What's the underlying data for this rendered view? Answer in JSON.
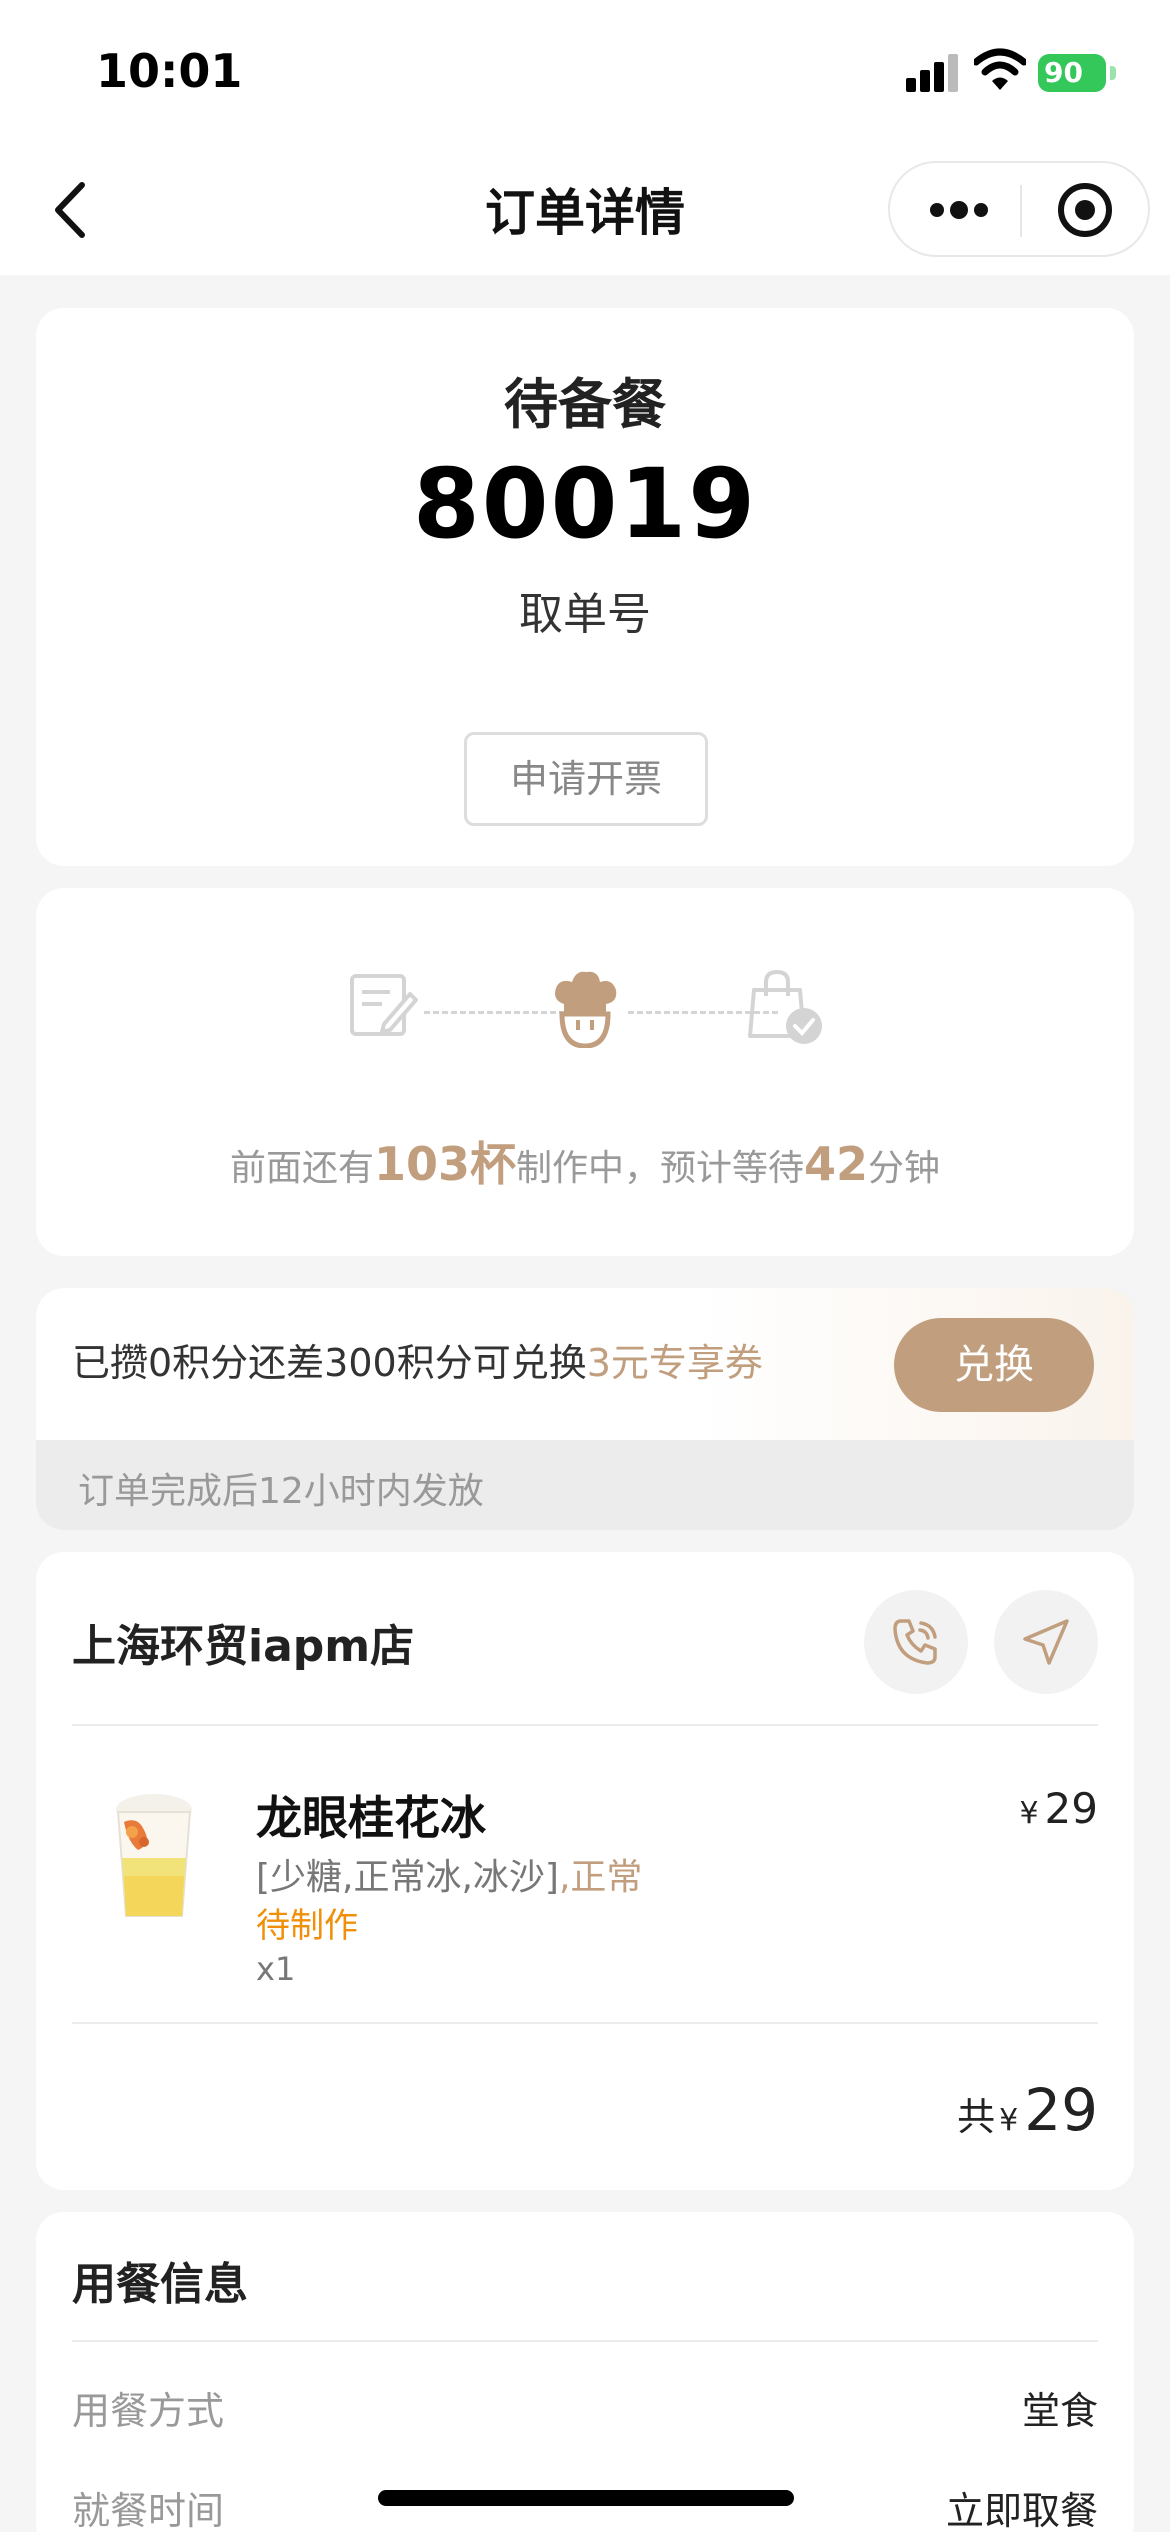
{
  "status_bar": {
    "time": "10:01",
    "battery": "90"
  },
  "nav": {
    "title": "订单详情"
  },
  "order": {
    "status": "待备餐",
    "pickup_number": "80019",
    "pickup_label": "取单号",
    "invoice_button": "申请开票"
  },
  "progress": {
    "prefix": "前面还有",
    "cups": "103杯",
    "middle": "制作中，预计等待",
    "minutes": "42",
    "suffix": "分钟"
  },
  "points": {
    "text": "已攒0积分还差300积分可兑换",
    "reward": "3元专享券",
    "redeem_button": "兑换",
    "note": "订单完成后12小时内发放"
  },
  "store": {
    "name": "上海环贸iapm店",
    "icons": [
      "phone-icon",
      "navigate-icon"
    ]
  },
  "items": [
    {
      "name": "龙眼桂花冰",
      "spec": "[少糖,正常冰,冰沙]",
      "spec_accent": ",正常",
      "state": "待制作",
      "qty": "x1",
      "currency": "¥",
      "price": "29"
    }
  ],
  "total": {
    "label": "共",
    "currency": "¥",
    "amount": "29"
  },
  "dining": {
    "title": "用餐信息",
    "rows": [
      {
        "key": "用餐方式",
        "value": "堂食"
      },
      {
        "key": "就餐时间",
        "value": "立即取餐"
      }
    ]
  },
  "colors": {
    "accent": "#c19e7e",
    "pending": "#f0900a",
    "battery": "#34c759"
  }
}
